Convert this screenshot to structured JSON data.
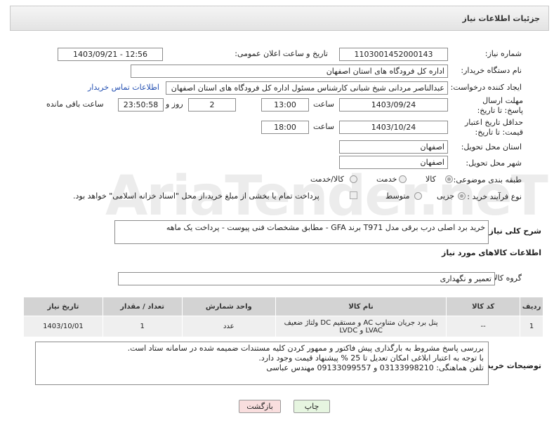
{
  "header": {
    "title": "جزئیات اطلاعات نیاز"
  },
  "form": {
    "need_number_label": "شماره نیاز:",
    "need_number": "1103001452000143",
    "announce_label": "تاریخ و ساعت اعلان عمومی:",
    "announce_value": "1403/09/21 - 12:56",
    "buyer_org_label": "نام دستگاه خریدار:",
    "buyer_org": "اداره کل فرودگاه های استان اصفهان",
    "creator_label": "ایجاد کننده درخواست:",
    "creator": "عبدالناصر مردانی شیخ شبانی کارشناس مسئول  اداره کل فرودگاه های استان اصفهان",
    "contact_link": "اطلاعات تماس خریدار",
    "deadline_label": "مهلت ارسال پاسخ: تا تاریخ:",
    "deadline_date": "1403/09/24",
    "time_label": "ساعت",
    "deadline_time": "13:00",
    "days_value": "2",
    "days_label": "روز و",
    "remaining_value": "23:50:58",
    "remaining_label": "ساعت باقی مانده",
    "validity_label": "حداقل تاریخ اعتبار قیمت: تا تاریخ:",
    "validity_date": "1403/10/24",
    "validity_time_label": "ساعت",
    "validity_time": "18:00",
    "province_label": "استان محل تحویل:",
    "province": "اصفهان",
    "city_label": "شهر محل تحویل:",
    "city": "اصفهان",
    "category_label": "طبقه بندی موضوعی:",
    "category_options": [
      "کالا",
      "خدمت",
      "کالا/خدمت"
    ],
    "purchase_type_label": "نوع فرآیند خرید :",
    "purchase_options": [
      "جزیی",
      "متوسط"
    ],
    "payment_note": "پرداخت تمام یا بخشی از مبلغ خرید،از محل \"اسناد خزانه اسلامی\" خواهد بود."
  },
  "description": {
    "label": "شرح کلی نیاز:",
    "text": "خرید برد اصلی درب برقی مدل T971  برند GFA - مطابق مشخصات فنی پیوست - پرداخت یک ماهه"
  },
  "goods": {
    "section_title": "اطلاعات کالاهای مورد نیاز",
    "group_label": "گروه کالا:",
    "group_value": "تعمیر و نگهداری",
    "columns": [
      "ردیف",
      "کد کالا",
      "نام کالا",
      "واحد شمارش",
      "تعداد / مقدار",
      "تاریخ نیاز"
    ],
    "rows": [
      {
        "row": "1",
        "code": "--",
        "name": "پنل برد جریان متناوب AC و مستقیم DC ولتاژ ضعیف LVAC و LVDC",
        "unit": "عدد",
        "qty": "1",
        "date": "1403/10/01"
      }
    ]
  },
  "buyer_notes": {
    "label": "توضیحات خریدار:",
    "line1": "بررسی پاسخ مشروط  به بارگذاری پیش فاکتور و ممهور کردن کلیه مستندات ضمیمه شده در سامانه  ستاد است.",
    "line2": "با توجه به اعتبار ابلاغی امکان تعدیل تا 25 % پیشنهاد قیمت وجود دارد.",
    "line3": "تلفن هماهنگی: 03133998210 و 09133099557 مهندس عباسی"
  },
  "buttons": {
    "print": "چاپ",
    "back": "بازگشت"
  },
  "watermark": "AriaTender.neT",
  "colors": {
    "link": "#2450b2",
    "print_bg": "#e6f5e0",
    "back_bg": "#f9dede"
  }
}
